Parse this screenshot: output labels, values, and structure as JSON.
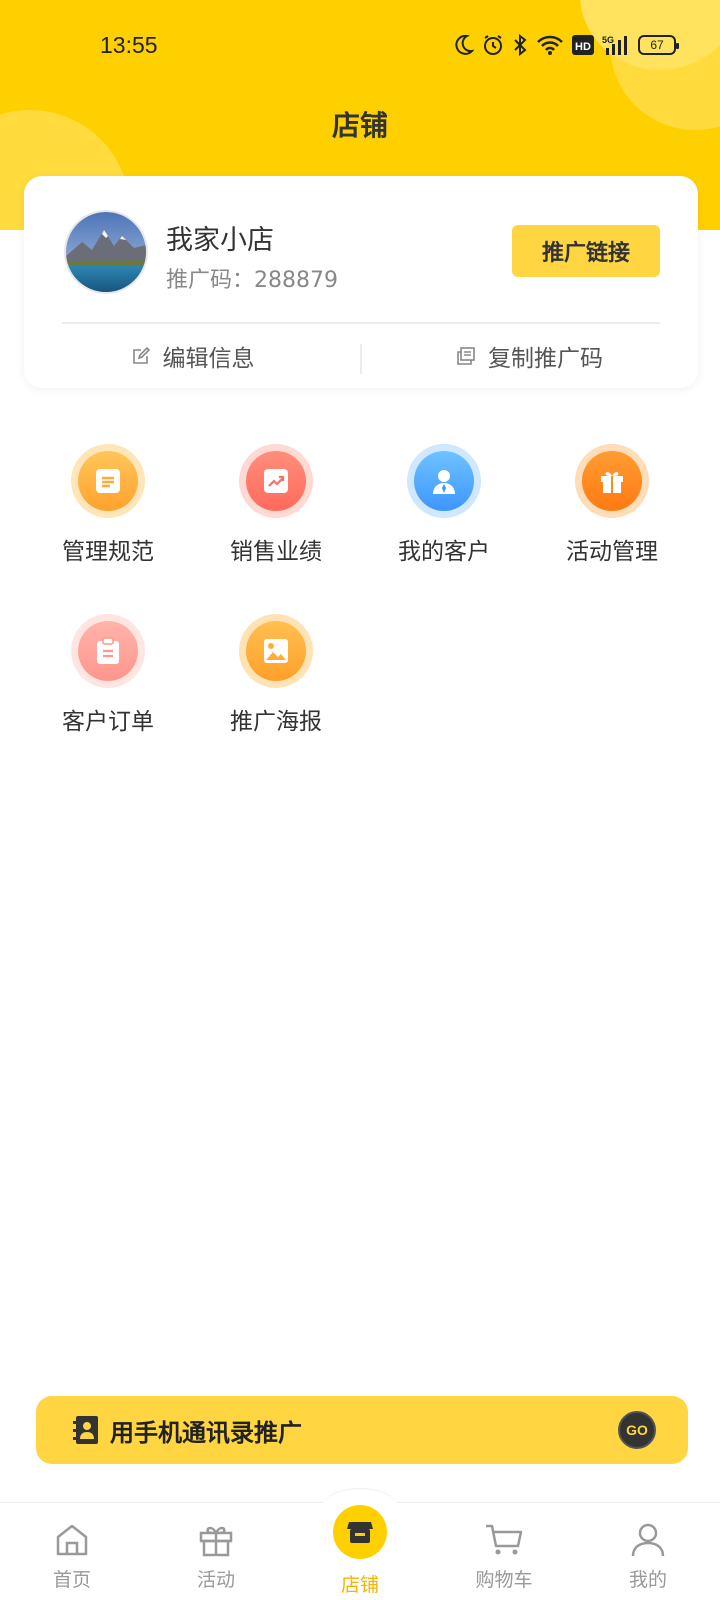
{
  "status_bar": {
    "time": "13:55",
    "battery": "67",
    "icons": [
      "moon-icon",
      "alarm-icon",
      "bluetooth-icon",
      "wifi-icon",
      "hd-icon",
      "signal-5g-icon",
      "battery-icon"
    ]
  },
  "header": {
    "title": "店铺",
    "color": "#FFD000"
  },
  "shop_card": {
    "name": "我家小店",
    "promo_code_label": "推广码：288879",
    "promo_link_button": "推广链接",
    "edit_info": "编辑信息",
    "copy_code": "复制推广码"
  },
  "menu": {
    "items": [
      {
        "label": "管理规范",
        "icon": "document-icon",
        "color": "#FFB43C"
      },
      {
        "label": "销售业绩",
        "icon": "trend-chart-icon",
        "color": "#FF7B6B"
      },
      {
        "label": "我的客户",
        "icon": "user-icon",
        "color": "#4AA8FF"
      },
      {
        "label": "活动管理",
        "icon": "gift-icon",
        "color": "#FF8A1F"
      },
      {
        "label": "客户订单",
        "icon": "clipboard-icon",
        "color": "#FFA29A"
      },
      {
        "label": "推广海报",
        "icon": "image-icon",
        "color": "#FFAE35"
      }
    ]
  },
  "banner": {
    "text": "用手机通讯录推广",
    "go": "GO"
  },
  "tabbar": {
    "items": [
      {
        "label": "首页",
        "icon": "home-icon"
      },
      {
        "label": "活动",
        "icon": "gift-icon"
      },
      {
        "label": "店铺",
        "icon": "store-icon",
        "active": true
      },
      {
        "label": "购物车",
        "icon": "cart-icon"
      },
      {
        "label": "我的",
        "icon": "profile-icon"
      }
    ],
    "active_color": "#F5B400"
  }
}
